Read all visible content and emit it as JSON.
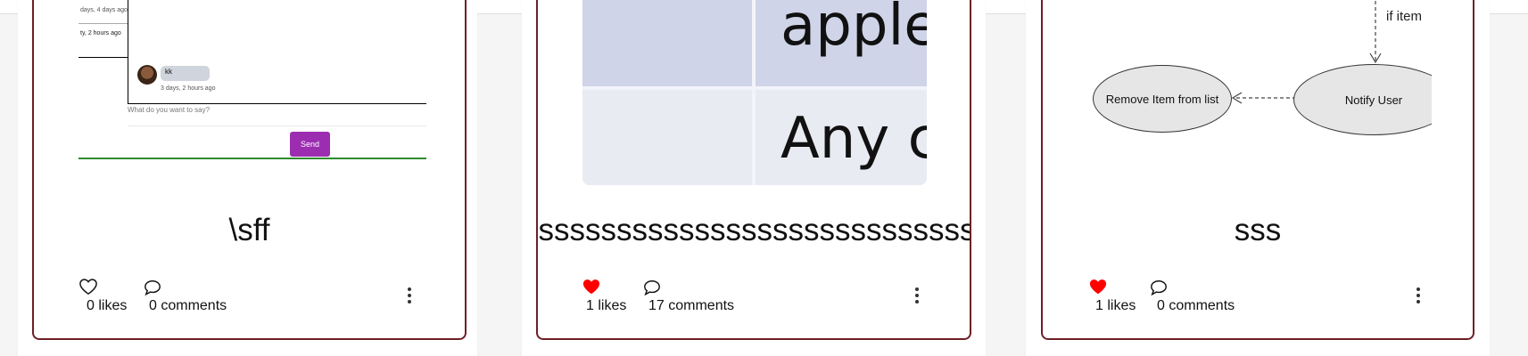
{
  "cards": [
    {
      "title": "\\sff",
      "likes_label": "0 likes",
      "comments_label": "0 comments",
      "liked": false,
      "thumbnail": {
        "timestamp_1": "days, 4 days ago",
        "timestamp_2": "ty, 2 hours ago",
        "comment_user": "kk",
        "comment_time": "3 days, 2 hours ago",
        "input_placeholder": "What do you want to say?",
        "send_label": "Send"
      }
    },
    {
      "title": "ssssssssssssssssssssssssssssssssss",
      "likes_label": "1 likes",
      "comments_label": "17 comments",
      "liked": true,
      "thumbnail": {
        "row1_text": "apple",
        "row2_text": "Any c"
      }
    },
    {
      "title": "sss",
      "likes_label": "1 likes",
      "comments_label": "0 comments",
      "liked": true,
      "thumbnail": {
        "edge_label": "if item",
        "node_left": "Remove Item from list",
        "node_right": "Notify User"
      }
    }
  ],
  "icons": {
    "like": "heart-icon",
    "comment": "chat-bubble-icon",
    "more": "more-vertical-icon"
  },
  "colors": {
    "card_border": "#6e1f26",
    "liked_heart": "#ff0000",
    "send_button": "#9c2db0",
    "input_underline": "#2e8b2e"
  }
}
